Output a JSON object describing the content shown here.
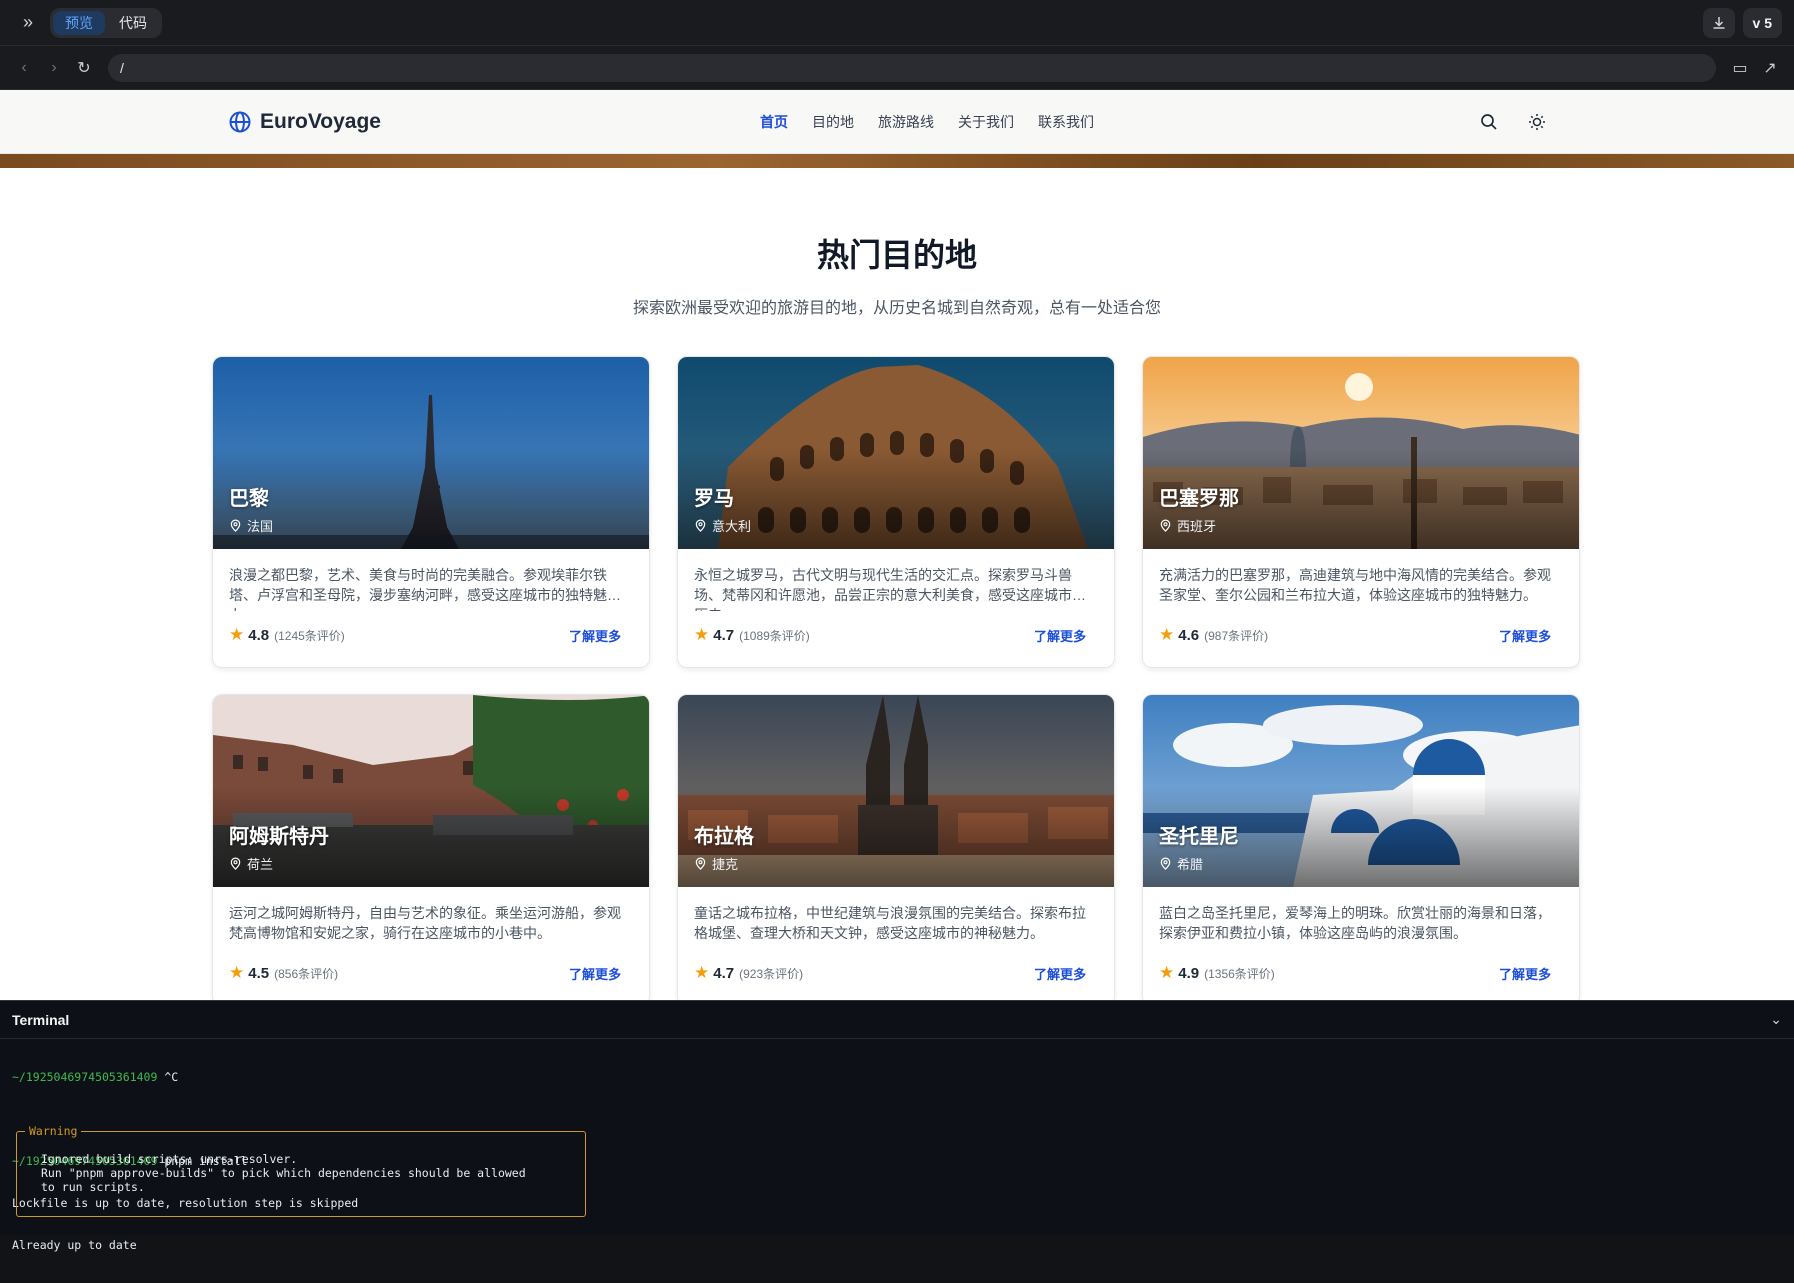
{
  "ide": {
    "tabs": [
      {
        "label": "预览",
        "active": true
      },
      {
        "label": "代码",
        "active": false
      }
    ],
    "version": "v 5",
    "url": "/"
  },
  "site": {
    "brand": "EuroVoyage",
    "nav": [
      {
        "label": "首页",
        "active": true
      },
      {
        "label": "目的地",
        "active": false
      },
      {
        "label": "旅游路线",
        "active": false
      },
      {
        "label": "关于我们",
        "active": false
      },
      {
        "label": "联系我们",
        "active": false
      }
    ],
    "section_title": "热门目的地",
    "section_subtitle": "探索欧洲最受欢迎的旅游目的地，从历史名城到自然奇观，总有一处适合您",
    "more_label": "了解更多",
    "cards": [
      {
        "city": "巴黎",
        "country": "法国",
        "desc": "浪漫之都巴黎，艺术、美食与时尚的完美融合。参观埃菲尔铁塔、卢浮宫和圣母院，漫步塞纳河畔，感受这座城市的独特魅力。",
        "rating": "4.8",
        "reviews": "(1245条评价)"
      },
      {
        "city": "罗马",
        "country": "意大利",
        "desc": "永恒之城罗马，古代文明与现代生活的交汇点。探索罗马斗兽场、梵蒂冈和许愿池，品尝正宗的意大利美食，感受这座城市的历史...",
        "rating": "4.7",
        "reviews": "(1089条评价)"
      },
      {
        "city": "巴塞罗那",
        "country": "西班牙",
        "desc": "充满活力的巴塞罗那，高迪建筑与地中海风情的完美结合。参观圣家堂、奎尔公园和兰布拉大道，体验这座城市的独特魅力。",
        "rating": "4.6",
        "reviews": "(987条评价)"
      },
      {
        "city": "阿姆斯特丹",
        "country": "荷兰",
        "desc": "运河之城阿姆斯特丹，自由与艺术的象征。乘坐运河游船，参观梵高博物馆和安妮之家，骑行在这座城市的小巷中。",
        "rating": "4.5",
        "reviews": "(856条评价)"
      },
      {
        "city": "布拉格",
        "country": "捷克",
        "desc": "童话之城布拉格，中世纪建筑与浪漫氛围的完美结合。探索布拉格城堡、查理大桥和天文钟，感受这座城市的神秘魅力。",
        "rating": "4.7",
        "reviews": "(923条评价)"
      },
      {
        "city": "圣托里尼",
        "country": "希腊",
        "desc": "蓝白之岛圣托里尼，爱琴海上的明珠。欣赏壮丽的海景和日落，探索伊亚和费拉小镇，体验这座岛屿的浪漫氛围。",
        "rating": "4.9",
        "reviews": "(1356条评价)"
      }
    ]
  },
  "terminal": {
    "title": "Terminal",
    "lines": [
      {
        "prompt": "~/1925046974505361409",
        "text": " ^C"
      },
      {
        "prompt": "",
        "text": ""
      },
      {
        "prompt": "~/1925046974505361409",
        "text": " pnpm install"
      },
      {
        "prompt": "",
        "text": "Lockfile is up to date, resolution step is skipped"
      },
      {
        "prompt": "",
        "text": "Already up to date"
      }
    ],
    "warning_label": "Warning",
    "warning_text": "Ignored build scripts: unrs-resolver.\nRun \"pnpm approve-builds\" to pick which dependencies should be allowed\nto run scripts."
  }
}
